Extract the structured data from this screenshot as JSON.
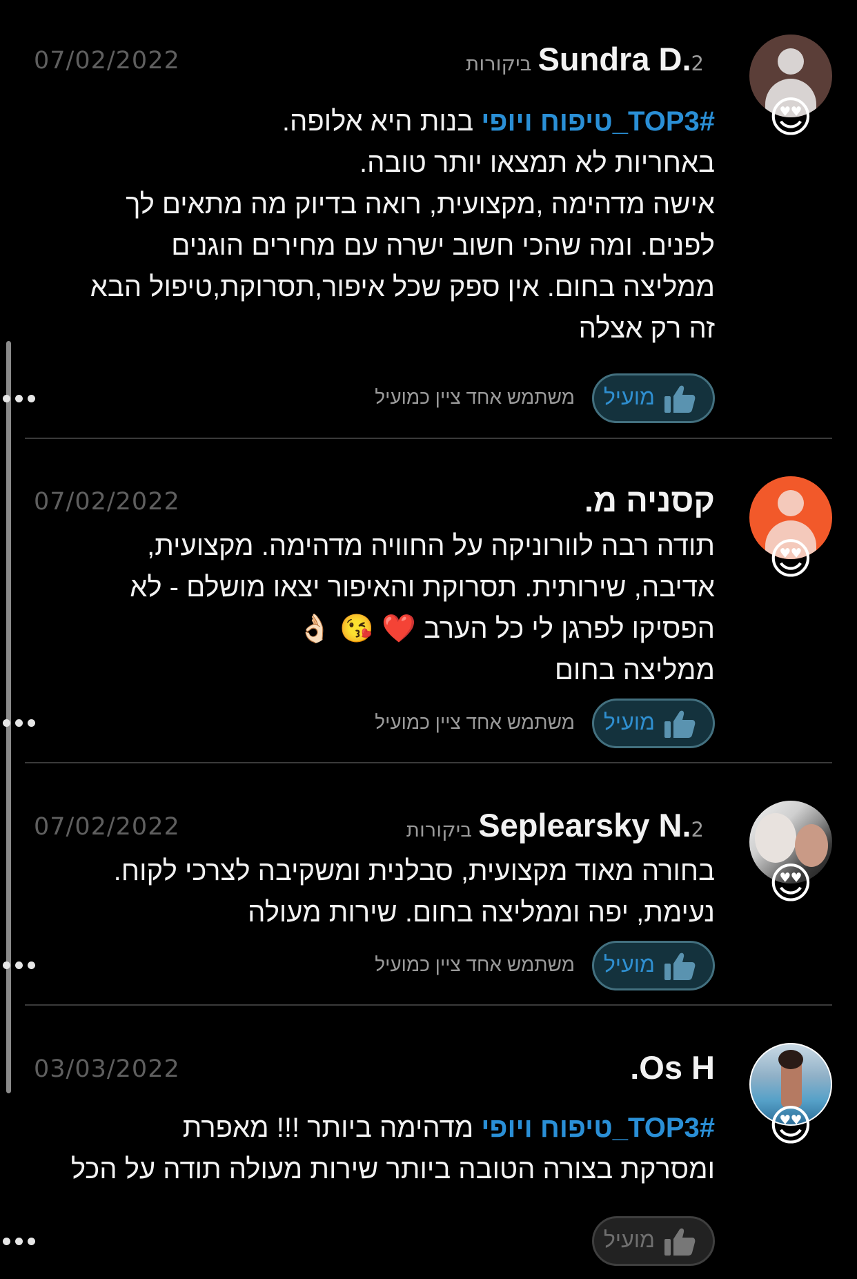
{
  "reviews": [
    {
      "name": "Sundra D.",
      "review_count": "2 ביקורות",
      "date": "07/02/2022",
      "hashtag": "#TOP3_טיפוח ויופי",
      "lines": [
        " בנות היא אלופה.",
        "באחריות לא תמצאו יותר טובה.",
        "אישה מדהימה ,מקצועית, רואה בדיוק מה מתאים לך",
        "לפנים. ומה שהכי חשוב ישרה עם מחירים הוגנים",
        "ממליצה בחום. אין ספק שכל איפור,תסרוקת,טיפול הבא",
        "זה רק אצלה"
      ],
      "helpful_label": "מועיל",
      "helpful_note": "משתמש אחד ציין כמועיל",
      "emoji": "😍"
    },
    {
      "name": "קסניה מ.",
      "review_count": "",
      "date": "07/02/2022",
      "lines": [
        "תודה רבה לוורוניקה על החוויה מדהימה. מקצועית,",
        "אדיבה, שירותית. תסרוקת והאיפור יצאו מושלם - לא",
        "הפסיקו לפרגן לי כל הערב ❤️ 😘 👌🏻",
        "ממליצה בחום"
      ],
      "helpful_label": "מועיל",
      "helpful_note": "משתמש אחד ציין כמועיל",
      "emoji": "😍"
    },
    {
      "name": "Seplearsky N.",
      "review_count": "2 ביקורות",
      "date": "07/02/2022",
      "lines": [
        "בחורה מאוד מקצועית,  סבלנית ומשקיבה לצרכי לקוח.",
        "נעימת,  יפה וממליצה בחום.  שירות מעולה"
      ],
      "helpful_label": "מועיל",
      "helpful_note": "משתמש אחד ציין כמועיל",
      "emoji": "😍"
    },
    {
      "name": "Os H.",
      "review_count": "",
      "date": "03/03/2022",
      "hashtag": "#TOP3_טיפוח ויופי",
      "lines": [
        " מדהימה ביותר !!!  מאפרת",
        "ומסרקת בצורה הטובה ביותר שירות מעולה תודה על הכל"
      ],
      "helpful_label": "מועיל",
      "emoji": "😍"
    }
  ],
  "colors": {
    "hashtag": "#2a8fd6",
    "helpful_active_bg": "#14323d",
    "helpful_active_border": "#43707f",
    "helpful_inactive_bg": "#222222"
  }
}
